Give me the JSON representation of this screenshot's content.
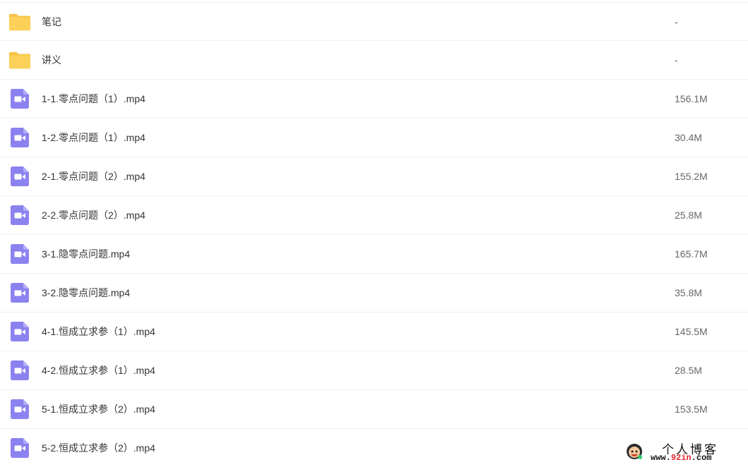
{
  "files": [
    {
      "type": "folder",
      "icon": "folder-icon",
      "name": "笔记",
      "size": "-"
    },
    {
      "type": "folder",
      "icon": "folder-icon",
      "name": "讲义",
      "size": "-"
    },
    {
      "type": "video",
      "icon": "video-file-icon",
      "name": "1-1.零点问题（1）.mp4",
      "size": "156.1M"
    },
    {
      "type": "video",
      "icon": "video-file-icon",
      "name": "1-2.零点问题（1）.mp4",
      "size": "30.4M"
    },
    {
      "type": "video",
      "icon": "video-file-icon",
      "name": "2-1.零点问题（2）.mp4",
      "size": "155.2M"
    },
    {
      "type": "video",
      "icon": "video-file-icon",
      "name": "2-2.零点问题（2）.mp4",
      "size": "25.8M"
    },
    {
      "type": "video",
      "icon": "video-file-icon",
      "name": "3-1.隐零点问题.mp4",
      "size": "165.7M"
    },
    {
      "type": "video",
      "icon": "video-file-icon",
      "name": "3-2.隐零点问题.mp4",
      "size": "35.8M"
    },
    {
      "type": "video",
      "icon": "video-file-icon",
      "name": "4-1.恒成立求参（1）.mp4",
      "size": "145.5M"
    },
    {
      "type": "video",
      "icon": "video-file-icon",
      "name": "4-2.恒成立求参（1）.mp4",
      "size": "28.5M"
    },
    {
      "type": "video",
      "icon": "video-file-icon",
      "name": "5-1.恒成立求参（2）.mp4",
      "size": "153.5M"
    },
    {
      "type": "video",
      "icon": "video-file-icon",
      "name": "5-2.恒成立求参（2）.mp4",
      "size": ""
    }
  ],
  "watermark": {
    "title": "个人博客",
    "url_prefix": "www.",
    "url_accent": "92in",
    "url_suffix": ".com"
  },
  "colors": {
    "folder": "#fcd15a",
    "folder_tab": "#f6c343",
    "video": "#8b82f0",
    "row_divider": "#f0f0f3"
  }
}
